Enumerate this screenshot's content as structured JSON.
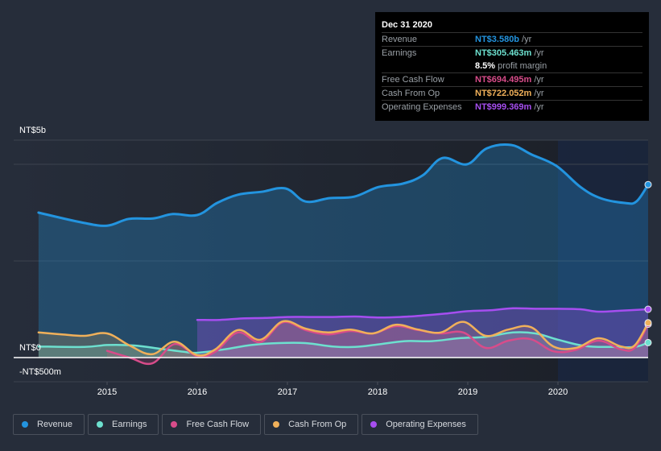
{
  "tooltip": {
    "date": "Dec 31 2020",
    "rows": [
      {
        "label": "Revenue",
        "value": "NT$3.580b",
        "unit": "/yr",
        "color": "#2394df"
      },
      {
        "label": "Earnings",
        "value": "NT$305.463m",
        "unit": "/yr",
        "color": "#6de0cf"
      },
      {
        "label": "",
        "value": "8.5%",
        "unit": "profit margin",
        "color": "#ffffff"
      },
      {
        "label": "Free Cash Flow",
        "value": "NT$694.495m",
        "unit": "/yr",
        "color": "#d84c8a"
      },
      {
        "label": "Cash From Op",
        "value": "NT$722.052m",
        "unit": "/yr",
        "color": "#f0b05a"
      },
      {
        "label": "Operating Expenses",
        "value": "NT$999.369m",
        "unit": "/yr",
        "color": "#a64ef0"
      }
    ]
  },
  "legend": [
    {
      "label": "Revenue",
      "color": "#2394df"
    },
    {
      "label": "Earnings",
      "color": "#6de0cf"
    },
    {
      "label": "Free Cash Flow",
      "color": "#d84c8a"
    },
    {
      "label": "Cash From Op",
      "color": "#f0b05a"
    },
    {
      "label": "Operating Expenses",
      "color": "#a64ef0"
    }
  ],
  "chart_data": {
    "type": "area",
    "title": "",
    "xlabel": "",
    "ylabel": "",
    "y_tick_labels": [
      "NT$5b",
      "NT$0",
      "-NT$500m"
    ],
    "x_tick_labels": [
      "2015",
      "2016",
      "2017",
      "2018",
      "2019",
      "2020"
    ],
    "xlim": [
      2014.24,
      2021.0
    ],
    "ylim": [
      -0.5,
      4.5
    ],
    "units": "NT$ billions",
    "highlight_range": [
      2020.0,
      2021.0
    ],
    "grid": true,
    "legend_position": "bottom-left",
    "series": [
      {
        "name": "Revenue",
        "color": "#2394df",
        "x": [
          2014.24,
          2014.71,
          2015.0,
          2015.24,
          2015.51,
          2015.73,
          2016.0,
          2016.22,
          2016.45,
          2016.71,
          2016.98,
          2017.2,
          2017.47,
          2017.74,
          2018.01,
          2018.28,
          2018.5,
          2018.72,
          2018.99,
          2019.21,
          2019.48,
          2019.71,
          2019.98,
          2020.25,
          2020.47,
          2020.74,
          2020.87,
          2021.0
        ],
        "values": [
          3.0,
          2.8,
          2.73,
          2.87,
          2.88,
          2.97,
          2.95,
          3.2,
          3.37,
          3.43,
          3.5,
          3.23,
          3.3,
          3.33,
          3.53,
          3.6,
          3.77,
          4.13,
          4.0,
          4.33,
          4.4,
          4.2,
          3.97,
          3.53,
          3.3,
          3.2,
          3.23,
          3.58
        ]
      },
      {
        "name": "Earnings",
        "color": "#6de0cf",
        "x": [
          2014.24,
          2014.75,
          2015.0,
          2015.3,
          2015.6,
          2015.85,
          2016.0,
          2016.3,
          2016.6,
          2016.9,
          2017.2,
          2017.5,
          2017.75,
          2018.0,
          2018.3,
          2018.6,
          2018.9,
          2019.2,
          2019.5,
          2019.75,
          2020.0,
          2020.3,
          2020.6,
          2020.85,
          2021.0
        ],
        "values": [
          0.23,
          0.22,
          0.26,
          0.25,
          0.18,
          0.12,
          0.1,
          0.17,
          0.26,
          0.3,
          0.3,
          0.23,
          0.22,
          0.27,
          0.34,
          0.34,
          0.4,
          0.43,
          0.52,
          0.5,
          0.37,
          0.24,
          0.22,
          0.22,
          0.31
        ]
      },
      {
        "name": "Free Cash Flow",
        "color": "#d84c8a",
        "x": [
          2015.0,
          2015.25,
          2015.5,
          2015.75,
          2016.0,
          2016.2,
          2016.45,
          2016.7,
          2016.95,
          2017.2,
          2017.45,
          2017.7,
          2017.95,
          2018.2,
          2018.45,
          2018.7,
          2018.95,
          2019.2,
          2019.45,
          2019.7,
          2019.95,
          2020.2,
          2020.45,
          2020.7,
          2020.85,
          2021.0
        ],
        "values": [
          0.14,
          0.0,
          -0.12,
          0.28,
          0.03,
          0.12,
          0.52,
          0.32,
          0.73,
          0.57,
          0.48,
          0.55,
          0.5,
          0.65,
          0.57,
          0.5,
          0.52,
          0.2,
          0.35,
          0.38,
          0.13,
          0.16,
          0.35,
          0.17,
          0.2,
          0.69
        ]
      },
      {
        "name": "Cash From Op",
        "color": "#f0b05a",
        "x": [
          2014.24,
          2014.5,
          2014.75,
          2015.0,
          2015.25,
          2015.5,
          2015.75,
          2016.0,
          2016.2,
          2016.45,
          2016.7,
          2016.95,
          2017.2,
          2017.45,
          2017.7,
          2017.95,
          2018.2,
          2018.45,
          2018.7,
          2018.95,
          2019.2,
          2019.45,
          2019.7,
          2019.95,
          2020.2,
          2020.45,
          2020.7,
          2020.85,
          2021.0
        ],
        "values": [
          0.52,
          0.48,
          0.45,
          0.5,
          0.25,
          0.07,
          0.33,
          0.05,
          0.17,
          0.57,
          0.37,
          0.75,
          0.6,
          0.52,
          0.58,
          0.5,
          0.68,
          0.58,
          0.52,
          0.74,
          0.45,
          0.58,
          0.63,
          0.23,
          0.2,
          0.4,
          0.23,
          0.25,
          0.72
        ]
      },
      {
        "name": "Operating Expenses",
        "color": "#a64ef0",
        "x": [
          2016.0,
          2016.25,
          2016.5,
          2016.75,
          2017.0,
          2017.25,
          2017.5,
          2017.75,
          2018.0,
          2018.25,
          2018.5,
          2018.75,
          2019.0,
          2019.25,
          2019.5,
          2019.75,
          2020.0,
          2020.25,
          2020.45,
          2020.7,
          2021.0
        ],
        "values": [
          0.78,
          0.78,
          0.81,
          0.82,
          0.84,
          0.84,
          0.84,
          0.85,
          0.83,
          0.84,
          0.87,
          0.91,
          0.96,
          0.98,
          1.02,
          1.01,
          1.01,
          1.0,
          0.95,
          0.97,
          1.0
        ]
      }
    ]
  }
}
